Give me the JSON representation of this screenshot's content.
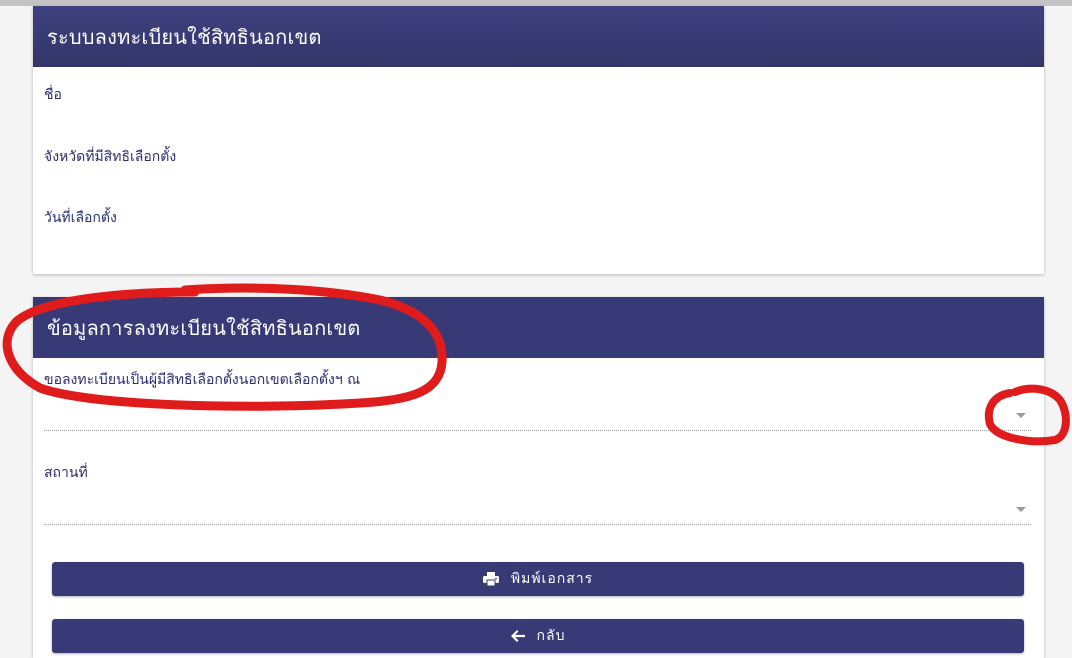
{
  "registration_card": {
    "title": "ระบบลงทะเบียนใช้สิทธินอกเขต",
    "rows": [
      {
        "label": "ชื่อ"
      },
      {
        "label": "จังหวัดที่มีสิทธิเลือกตั้ง"
      },
      {
        "label": "วันที่เลือกตั้ง"
      }
    ]
  },
  "details_card": {
    "title": "ข้อมูลการลงทะเบียนใช้สิทธินอกเขต",
    "location_select": {
      "label": "ขอลงทะเบียนเป็นผู้มีสิทธิเลือกตั้งนอกเขตเลือกตั้งฯ ณ",
      "value": ""
    },
    "place_select": {
      "label": "สถานที่",
      "value": ""
    },
    "print_button": {
      "label": "พิมพ์เอกสาร",
      "icon": "printer-icon"
    },
    "back_button": {
      "label": "กลับ",
      "icon": "arrow-left-icon"
    }
  },
  "colors": {
    "header": "#383a78",
    "text": "#2b2f6e",
    "annotation": "#e01b1b"
  }
}
